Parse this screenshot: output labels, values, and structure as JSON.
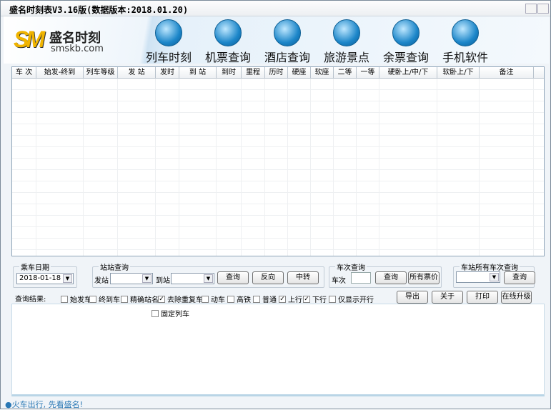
{
  "window": {
    "title": "盛名时刻表V3.16版(数据版本:2018.01.20)"
  },
  "logo": {
    "mark": "SM",
    "name": "盛名时刻",
    "site": "smskb.com"
  },
  "nav": [
    {
      "label": "列车时刻",
      "icon": "train-icon"
    },
    {
      "label": "机票查询",
      "icon": "airplane-icon"
    },
    {
      "label": "酒店查询",
      "icon": "hotel-icon"
    },
    {
      "label": "旅游景点",
      "icon": "globe-icon"
    },
    {
      "label": "余票查询",
      "icon": "windows-icon"
    },
    {
      "label": "手机软件",
      "icon": "java-icon"
    }
  ],
  "table": {
    "columns": [
      "车 次",
      "始发-终到",
      "列车等级",
      "发 站",
      "发时",
      "到 站",
      "到时",
      "里程",
      "历时",
      "硬座",
      "软座",
      "二等",
      "一等",
      "硬卧上/中/下",
      "软卧上/下",
      "备注"
    ],
    "rows": []
  },
  "date_group": {
    "label": "乘车日期",
    "value": "2018-01-18"
  },
  "station_group": {
    "label": "站站查询",
    "from_label": "发站",
    "from_value": "",
    "to_label": "到站",
    "to_value": "",
    "query": "查询",
    "reverse": "反向",
    "transfer": "中转"
  },
  "train_group": {
    "label": "车次查询",
    "train_label": "车次",
    "train_value": "",
    "query": "查询",
    "all_prices": "所有票价"
  },
  "station_all_group": {
    "label": "车站所有车次查询",
    "value": "",
    "query": "查询"
  },
  "filters": {
    "label": "查询结果:",
    "items": [
      {
        "label": "始发车",
        "checked": false
      },
      {
        "label": "终到车",
        "checked": false
      },
      {
        "label": "精确站名",
        "checked": false
      },
      {
        "label": "去除重复车",
        "checked": true
      },
      {
        "label": "动车",
        "checked": false
      },
      {
        "label": "高铁",
        "checked": false
      },
      {
        "label": "普通",
        "checked": false
      },
      {
        "label": "上行",
        "checked": true
      },
      {
        "label": "下行",
        "checked": true
      },
      {
        "label": "仅显示开行",
        "checked": false
      }
    ],
    "fixed": {
      "label": "固定列车",
      "checked": false
    }
  },
  "actions": {
    "export": "导出",
    "about": "关于",
    "print": "打印",
    "upgrade": "在线升级"
  },
  "status": {
    "text": "●火车出行, 先看盛名!"
  }
}
